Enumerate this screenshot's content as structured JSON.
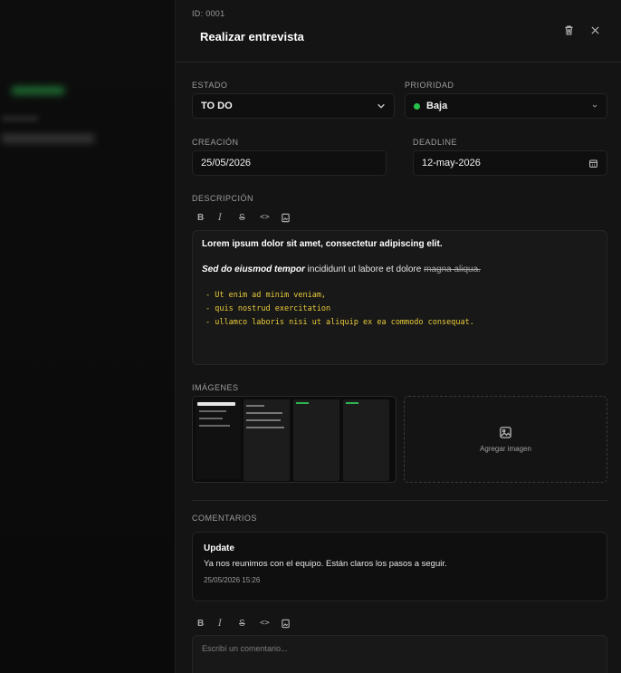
{
  "task": {
    "id": "ID: 0001",
    "title": "Realizar entrevista"
  },
  "fields": {
    "estado_label": "ESTADO",
    "estado_value": "TO DO",
    "prioridad_label": "PRIORIDAD",
    "prioridad_value": "Baja",
    "prioridad_color": "#27c24c",
    "creacion_label": "CREACIÓN",
    "creacion_value": "25/05/2026",
    "deadline_label": "DEADLINE",
    "deadline_value": "12-may-2026"
  },
  "description": {
    "label": "DESCRIPCIÓN",
    "toolbar": [
      "B",
      "I",
      "S",
      "<>",
      "image"
    ],
    "p1": "Lorem ipsum dolor sit amet, consectetur adipiscing elit.",
    "p2_bold_italic": "Sed do eiusmod tempor",
    "p2_plain": " incididunt ut labore et dolore ",
    "p2_strike": "magna aliqua.",
    "code_lines": [
      "- Ut enim ad minim veniam,",
      "- quis nostrud exercitation",
      "- ullamco laboris nisi ut aliquip ex ea commodo consequat."
    ]
  },
  "images": {
    "label": "IMÁGENES",
    "add_label": "Agregar imagen"
  },
  "comments": {
    "label": "COMENTARIOS",
    "items": [
      {
        "title": "Update",
        "body": "Ya nos reunimos con el equipo. Están claros los pasos a seguir.",
        "time": "25/05/2026 15:26"
      }
    ],
    "input_placeholder": "Escribí un comentario..."
  },
  "colors": {
    "accent_green": "#27c24c",
    "code_yellow": "#e8cb3a",
    "panel_bg": "#141414"
  },
  "icons": {
    "delete": "trash-icon",
    "close": "close-icon",
    "estado_dropdown": "chevron-down-icon",
    "calendar": "calendar-icon",
    "add_image": "image-icon"
  }
}
